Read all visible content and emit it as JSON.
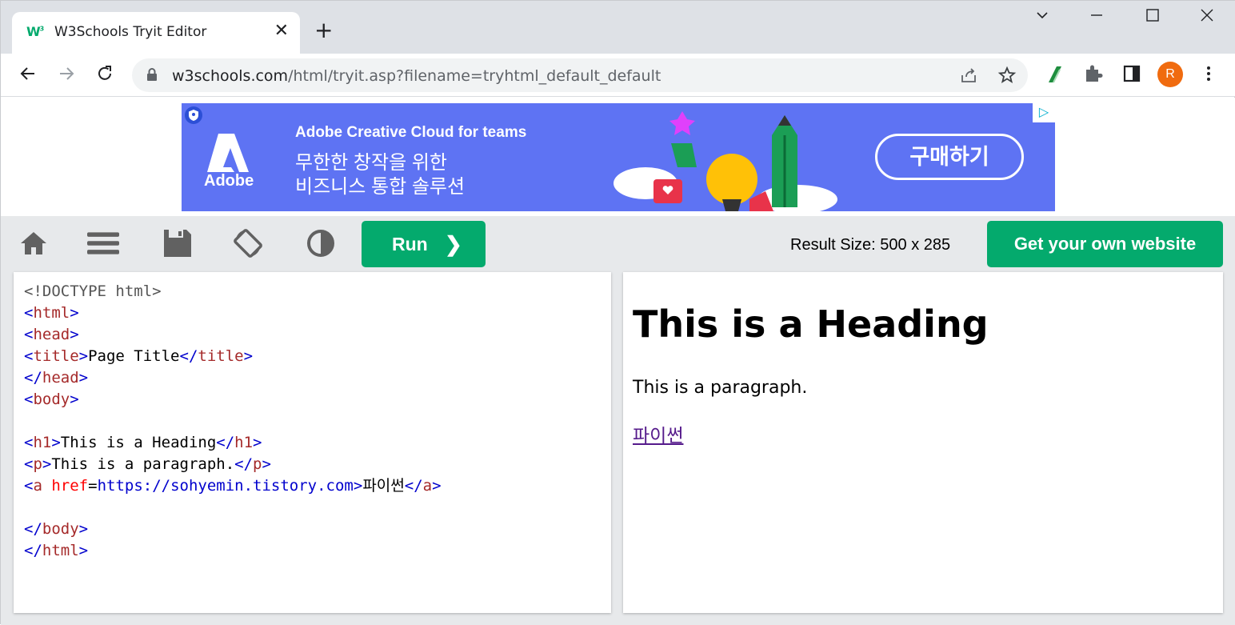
{
  "browser": {
    "tab_title": "W3Schools Tryit Editor",
    "tab_close": "✕",
    "new_tab": "+",
    "url_domain": "w3schools.com",
    "url_path": "/html/tryit.asp?filename=tryhtml_default_default",
    "profile_initial": "R",
    "favicon_text": "W",
    "favicon_sup": "3"
  },
  "ad": {
    "brand": "Adobe",
    "line1": "Adobe Creative Cloud for teams",
    "line2": "무한한 창작을 위한",
    "line3": "비즈니스 통합 솔루션",
    "cta": "구매하기",
    "choices_icon": "▷"
  },
  "editor": {
    "run_label": "Run",
    "run_chevron": "❯",
    "result_size": "Result Size: 500 x 285",
    "own_website_label": "Get your own website"
  },
  "code": {
    "doctype": "<!DOCTYPE html>",
    "title_text": "Page Title",
    "h1_text": "This is a Heading",
    "p_text": "This is a paragraph.",
    "href_attr": "href",
    "href_value": "https://sohyemin.tistory.com",
    "a_text": "파이썬"
  },
  "result": {
    "heading": "This is a Heading",
    "paragraph": "This is a paragraph.",
    "link": "파이썬"
  }
}
